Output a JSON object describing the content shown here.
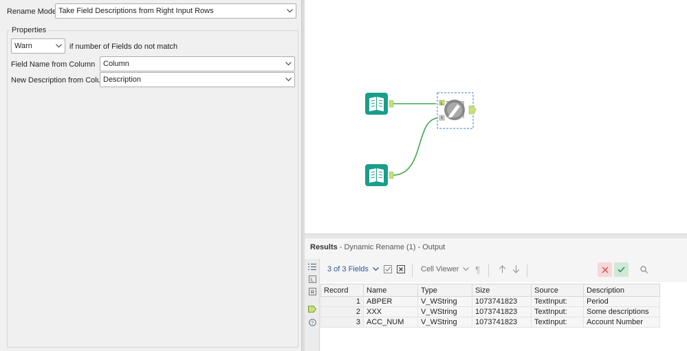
{
  "config": {
    "rename_mode_label": "Rename Mode:",
    "rename_mode_value": "Take Field Descriptions from Right Input Rows",
    "properties_legend": "Properties",
    "mismatch_value": "Warn",
    "mismatch_label": "if number of Fields do not match",
    "field_name_label": "Field Name from Column",
    "field_name_value": "Column",
    "new_desc_label": "New Description from Column",
    "new_desc_value": "Description"
  },
  "canvas": {
    "tools": [
      {
        "name": "text-input-1",
        "icon": "book-icon"
      },
      {
        "name": "text-input-2",
        "icon": "book-icon"
      },
      {
        "name": "dynamic-rename",
        "icon": "dynamic-rename-icon"
      }
    ],
    "anchor_left": "L",
    "anchor_right": "R",
    "colors": {
      "input_tool": "#1a9e8a",
      "connection": "#3aa84a",
      "anchor": "#c6e07a"
    }
  },
  "results": {
    "title_bold": "Results",
    "title_sub": " - Dynamic Rename (1) - Output",
    "fields_count": "3 of 3 Fields",
    "cell_viewer": "Cell Viewer",
    "columns": [
      "Record",
      "Name",
      "Type",
      "Size",
      "Source",
      "Description"
    ],
    "rows": [
      [
        "1",
        "ABPER",
        "V_WString",
        "1073741823",
        "TextInput:",
        "Period"
      ],
      [
        "2",
        "XXX",
        "V_WString",
        "1073741823",
        "TextInput:",
        "Some descriptions"
      ],
      [
        "3",
        "ACC_NUM",
        "V_WString",
        "1073741823",
        "TextInput:",
        "Account Number"
      ]
    ]
  }
}
